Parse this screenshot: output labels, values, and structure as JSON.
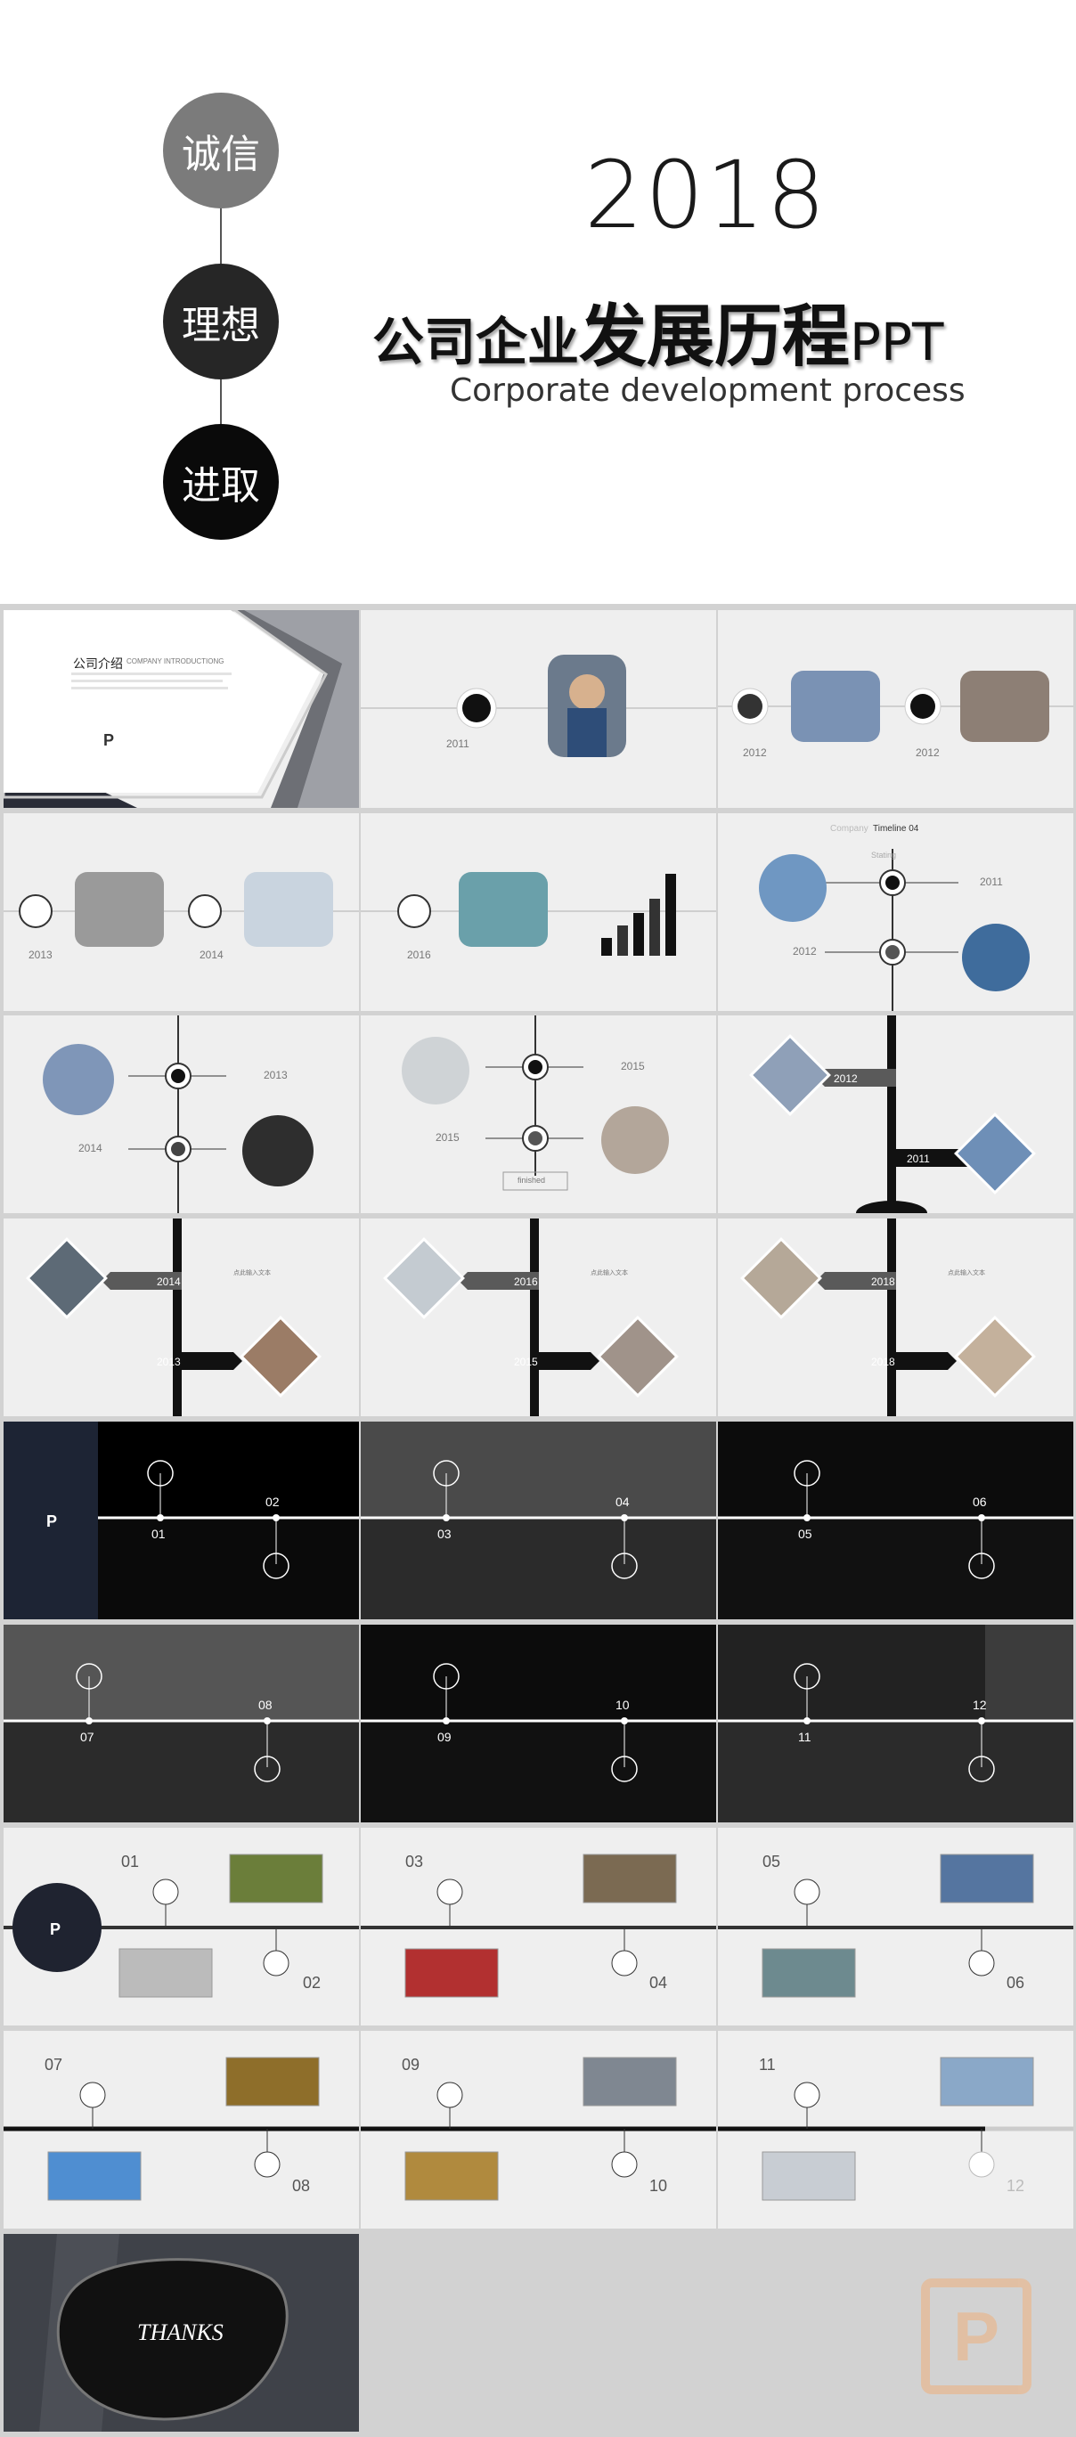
{
  "hero": {
    "circles": [
      "诚信",
      "理想",
      "进取"
    ],
    "year": "2018",
    "title_a": "公司企业",
    "title_b": "发展历程",
    "title_c": "PPT",
    "subtitle": "Corporate development process"
  },
  "intro": {
    "title": "公司介绍",
    "title_en": "COMPANY INTRODUCTIONG"
  },
  "timeline_years": [
    "2011",
    "2011",
    "2012",
    "2012",
    "2013",
    "2014",
    "2016"
  ],
  "company_timeline": {
    "title_a": "Company",
    "title_b": "Timeline 04",
    "starting": "Stating",
    "years": [
      "2011",
      "2012"
    ]
  },
  "circle_slides": {
    "a": [
      "2013",
      "2014"
    ],
    "b": [
      "2015",
      "2015"
    ],
    "finished": "finished"
  },
  "diamond_slides": {
    "a": [
      "2012",
      "2011"
    ],
    "b": [
      "2014",
      "2013"
    ],
    "c": [
      "2016",
      "2015"
    ],
    "d": [
      "2018",
      "2018"
    ]
  },
  "click_text": "点此输入文本",
  "dark_numbers": [
    "01",
    "02",
    "03",
    "04",
    "05",
    "06",
    "07",
    "08",
    "09",
    "10",
    "11",
    "12"
  ],
  "photo_numbers": [
    "01",
    "02",
    "03",
    "04",
    "05",
    "06",
    "07",
    "08",
    "09",
    "10",
    "11",
    "12"
  ],
  "thanks": "THANKS",
  "colors": {
    "dark": "#0c0c0c",
    "mid": "#2b2b2b",
    "light": "#efefef",
    "accent_gray": "#7b7b7b"
  }
}
